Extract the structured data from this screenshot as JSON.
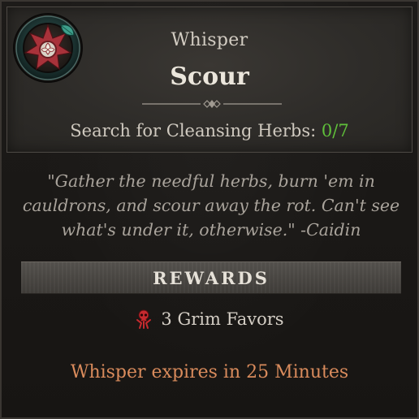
{
  "quest": {
    "type": "Whisper",
    "title": "Scour",
    "objective_label": "Search for Cleansing Herbs:",
    "objective_progress": "0/7",
    "flavor_text": "\"Gather the needful herbs, burn 'em in cauldrons, and scour away the rot. Can't see what's under it, otherwise.\" -Caidin"
  },
  "rewards": {
    "header": "REWARDS",
    "items": [
      {
        "icon": "grim-favor-icon",
        "text": "3 Grim Favors"
      }
    ]
  },
  "expiry": {
    "text": "Whisper expires in 25 Minutes"
  },
  "colors": {
    "progress": "#5fbf3a",
    "expiry": "#d98b5c",
    "emblem_red": "#a8323a",
    "leaf_teal": "#3ea08c"
  }
}
